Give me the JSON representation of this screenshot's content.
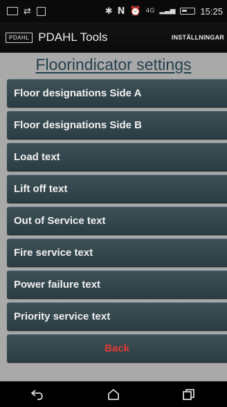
{
  "statusbar": {
    "time": "15:25",
    "network": "4G"
  },
  "appbar": {
    "logo": "PDAHL",
    "title": "PDAHL Tools",
    "action": "INSTÄLLNINGAR"
  },
  "page": {
    "title": "Floorindicator settings"
  },
  "menu": {
    "items": [
      {
        "label": "Floor designations Side A"
      },
      {
        "label": "Floor designations Side B"
      },
      {
        "label": "Load text"
      },
      {
        "label": "Lift off text"
      },
      {
        "label": "Out of Service text"
      },
      {
        "label": "Fire service text"
      },
      {
        "label": "Power failure text"
      },
      {
        "label": "Priority service text"
      }
    ],
    "back_label": "Back"
  },
  "colors": {
    "background": "#a9a9a9",
    "button": "#33474e",
    "title_text": "#24404c",
    "back_text": "#e03a37"
  },
  "icons": {
    "nav_back": "back-arrow-icon",
    "nav_home": "home-icon",
    "nav_recents": "recent-apps-icon"
  }
}
